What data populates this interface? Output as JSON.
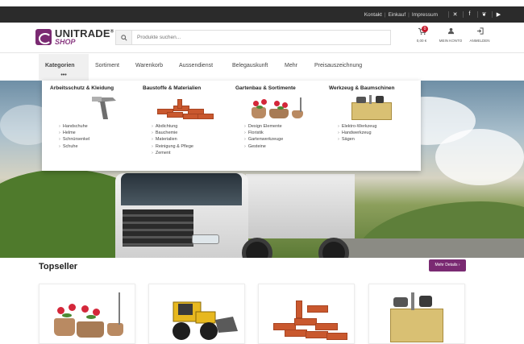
{
  "topbar": {
    "links": [
      "Kontakt",
      "Einkauf",
      "Impressum"
    ],
    "social_icons": [
      "xing-icon",
      "facebook-icon",
      "twitter-icon",
      "youtube-icon"
    ]
  },
  "header": {
    "logo": {
      "name": "UNITRADE",
      "registered": "®",
      "sub": "SHOP"
    },
    "search_placeholder": "Produkte suchen...",
    "cart": {
      "badge": "0",
      "label": "0,00 €"
    },
    "account_label": "MEIN KONTO",
    "login_label": "ANMELDEN"
  },
  "nav": {
    "items": [
      "Kategorien",
      "Sortiment",
      "Warenkorb",
      "Aussendienst",
      "Belegauskunft",
      "Mehr",
      "Preisauszeichnung"
    ],
    "active_dots": "•••"
  },
  "mega_menu": {
    "columns": [
      {
        "title": "Arbeitsschutz & Kleidung",
        "items": [
          "Handschuhe",
          "Helme",
          "Schnürsenkel",
          "Schuhe"
        ]
      },
      {
        "title": "Baustoffe & Materialien",
        "items": [
          "Abdichtung",
          "Bauchemie",
          "Materialien",
          "Reinigung & Pflege",
          "Zement"
        ]
      },
      {
        "title": "Gartenbau & Sortimente",
        "items": [
          "Design Elemente",
          "Floristik",
          "Gartenwerkzeuge",
          "Gesteine"
        ]
      },
      {
        "title": "Werkzeug & Baumschinen",
        "items": [
          "Elektro-Werkzeug",
          "Handwerkzeug",
          "Sägen"
        ]
      }
    ]
  },
  "topseller": {
    "title": "Topseller",
    "button": "Mehr Details ›"
  },
  "colors": {
    "brand": "#7a2a72",
    "topbar": "#2b2b2b",
    "badge": "#c41a2c"
  }
}
